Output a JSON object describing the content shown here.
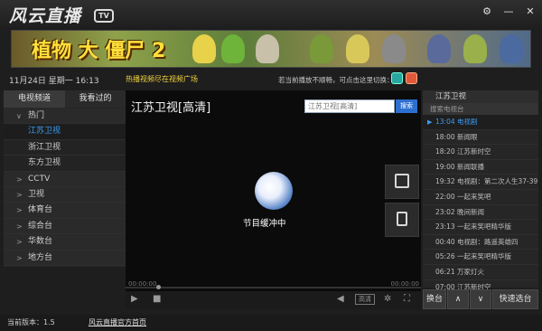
{
  "app": {
    "title": "风云直播",
    "tv_badge": "TV"
  },
  "window_buttons": {
    "settings": "⚙",
    "minimize": "—",
    "close": "✕"
  },
  "banner": {
    "title": "植物 大 僵尸 2"
  },
  "info": {
    "datetime": "11月24日 星期一 16:13",
    "promo": "热播视频尽在视频广场",
    "switch_hint": "若当前播放不顺畅，可点击这里切换："
  },
  "left": {
    "tabs": [
      "电视频道",
      "我看过的"
    ],
    "categories": [
      {
        "label": "热门",
        "arrow": "∨",
        "expanded": true
      },
      {
        "label": "江苏卫视",
        "selected": true
      },
      {
        "label": "浙江卫视"
      },
      {
        "label": "东方卫视"
      },
      {
        "label": "CCTV",
        "arrow": ">"
      },
      {
        "label": "卫视",
        "arrow": ">"
      },
      {
        "label": "体育台",
        "arrow": ">"
      },
      {
        "label": "综合台",
        "arrow": ">"
      },
      {
        "label": "华数台",
        "arrow": ">"
      },
      {
        "label": "地方台",
        "arrow": ">"
      }
    ]
  },
  "video": {
    "title": "江苏卫视[高清]",
    "search_value": "江苏卫视[高清]",
    "search_button": "搜索",
    "buffering": "节目缓冲中",
    "time_left": "00:00:00",
    "time_right": "00:00:00",
    "progress": 0.11,
    "hq_label": "高清"
  },
  "schedule": {
    "channel": "江苏卫视",
    "search_placeholder": "搜索电视台",
    "items": [
      {
        "text": "13:04 电视剧",
        "current": true
      },
      {
        "text": "18:00 新闻眼"
      },
      {
        "text": "18:20 江苏新时空"
      },
      {
        "text": "19:00 新闻联播"
      },
      {
        "text": "19:32 电视剧：第二次人生37-39"
      },
      {
        "text": "22:00 一起来笑吧"
      },
      {
        "text": "23:02 晚间新闻"
      },
      {
        "text": "23:13 一起来笑吧精华版"
      },
      {
        "text": "00:40 电视剧：路遥英雄四"
      },
      {
        "text": "05:26 一起来笑吧精华版"
      },
      {
        "text": "06:21 万家灯火"
      },
      {
        "text": "07:00 江苏新时空"
      }
    ]
  },
  "right_buttons": {
    "switch": "换台",
    "up": "∧",
    "down": "∨",
    "fast": "快速选台"
  },
  "footer": {
    "version": "当前版本：1.5",
    "homepage": "风云直播官方首页"
  },
  "colors": {
    "accent": "#3f9bf0",
    "promo": "#f2d23a",
    "background": "#1e1e1e"
  }
}
